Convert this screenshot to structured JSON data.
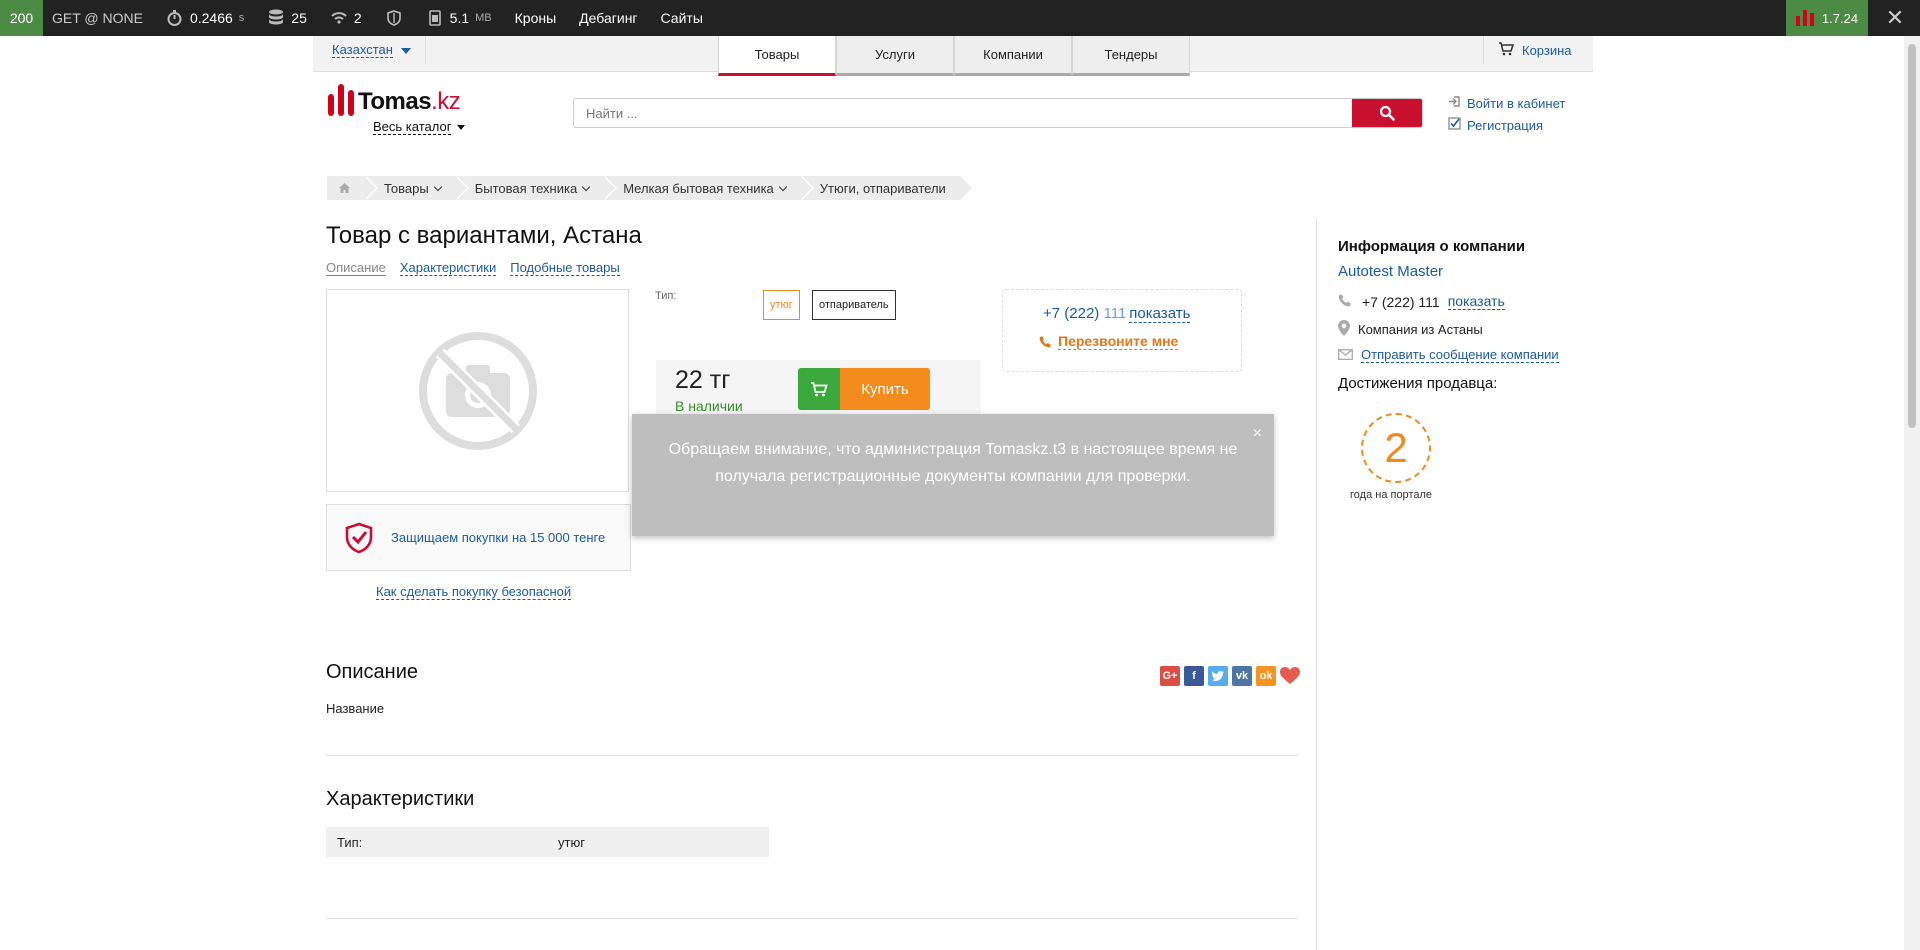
{
  "debug_bar": {
    "status": "200",
    "request": "GET @ NONE",
    "time": "0.2466",
    "time_unit": "s",
    "db_queries": "25",
    "events": "2",
    "memory": "5.1",
    "memory_unit": "MB",
    "links": [
      "Кроны",
      "Дебагинг",
      "Сайты"
    ],
    "version": "1.7.24"
  },
  "topbar": {
    "country": "Казахстан",
    "tabs": [
      "Товары",
      "Услуги",
      "Компании",
      "Тендеры"
    ],
    "active_tab": "Товары",
    "cart": "Корзина"
  },
  "header": {
    "logo_main": "Tomas",
    "logo_domain": ".kz",
    "catalog": "Весь каталог",
    "search_placeholder": "Найти ...",
    "login": "Войти в кабинет",
    "register": "Регистрация"
  },
  "breadcrumbs": [
    "Товары",
    "Бытовая техника",
    "Мелкая бытовая техника",
    "Утюги, отпариватели"
  ],
  "product": {
    "title": "Товар с вариантами, Астана",
    "subnav": [
      "Описание",
      "Характеристики",
      "Подобные товары"
    ],
    "protection": "Защищаем покупки на 15 000 тенге",
    "how_safe": "Как сделать покупку безопасной",
    "type_label": "Тип:",
    "variants": [
      "утюг",
      "отпариватель"
    ],
    "selected_variant": "утюг",
    "price": "22 тг",
    "stock": "В наличии",
    "buy": "Купить"
  },
  "contact_box": {
    "phone_prefix": "+7 (222)",
    "phone_visible": "111",
    "show": "показать",
    "callback": "Перезвоните мне"
  },
  "notice": {
    "text": "Обращаем внимание, что администрация Tomaskz.t3 в настоящее время не получала регистрационные документы компании для проверки.",
    "close": "×"
  },
  "description": {
    "heading": "Описание",
    "text": "Название"
  },
  "specs": {
    "heading": "Характеристики",
    "rows": [
      {
        "key": "Тип:",
        "value": "утюг"
      }
    ]
  },
  "sidebar": {
    "heading": "Информация о компании",
    "company": "Autotest Master",
    "phone": "+7 (222) 111",
    "show": "показать",
    "location": "Компания из Астаны",
    "message": "Отправить сообщение компании",
    "achievements": "Достижения продавца:",
    "years": "2",
    "years_caption": "года на портале"
  },
  "colors": {
    "brand_red": "#c8102e",
    "buy_green": "#3aa83a",
    "buy_orange": "#f38b1d",
    "link": "#1a5a9e",
    "debug_green": "#4b8b43"
  }
}
